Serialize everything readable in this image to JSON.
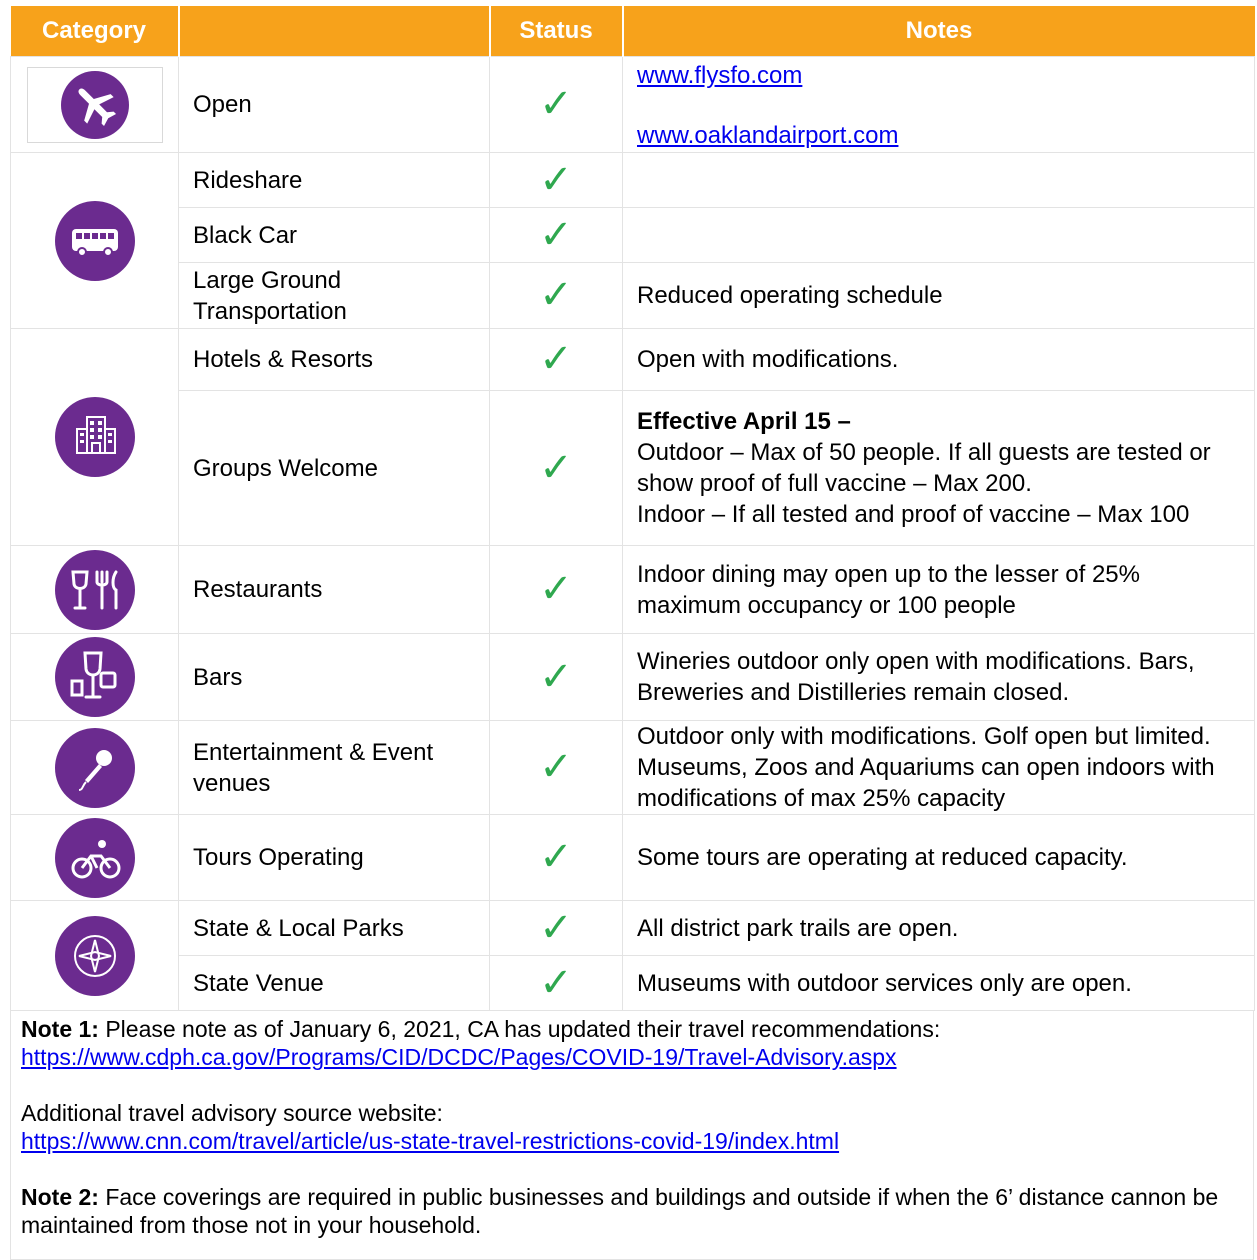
{
  "header": {
    "category": "Category",
    "status": "Status",
    "notes": "Notes"
  },
  "icons": {
    "air": "airplane-icon",
    "ground": "bus-icon",
    "lodging": "hotel-building-icon",
    "dining": "wine-fork-knife-icon",
    "bars": "cocktail-icon",
    "entertainment": "microphone-icon",
    "tours": "bicycle-icon",
    "parks": "compass-icon"
  },
  "colors": {
    "header_bg": "#f7a21b",
    "icon_bg": "#6b2b8f",
    "check": "#2fa84f",
    "link": "#0000ee"
  },
  "rows": {
    "open": {
      "name": "Open",
      "link1": "www.flysfo.com",
      "link2": "www.oaklandairport.com"
    },
    "rideshare": {
      "name": "Rideshare",
      "notes": ""
    },
    "blackcar": {
      "name": "Black Car",
      "notes": ""
    },
    "largeground": {
      "name_line1": "Large Ground",
      "name_line2": "Transportation",
      "notes": "Reduced operating schedule"
    },
    "hotels": {
      "name": "Hotels & Resorts",
      "notes": "Open with modifications."
    },
    "groups": {
      "name": "Groups Welcome",
      "notes_bold": "Effective April 15 –",
      "notes_line1": "Outdoor – Max of 50 people.  If all guests are tested or show proof of full vaccine – Max 200.",
      "notes_line2": "Indoor – If all tested and proof of vaccine – Max 100"
    },
    "restaurants": {
      "name": "Restaurants",
      "notes": "Indoor dining may open up to the lesser of 25% maximum occupancy or 100 people"
    },
    "bars": {
      "name": "Bars",
      "notes": "Wineries outdoor only open with modifications. Bars, Breweries and Distilleries remain closed."
    },
    "entertainment": {
      "name_line1": "Entertainment & Event",
      "name_line2": "venues",
      "notes": "Outdoor only with modifications.  Golf open but limited.  Museums, Zoos and Aquariums can open indoors with modifications of max 25% capacity"
    },
    "tours": {
      "name": "Tours Operating",
      "notes": "Some tours are operating at reduced capacity."
    },
    "parks": {
      "name": "State & Local Parks",
      "notes": "All district park trails are open."
    },
    "venue": {
      "name": "State Venue",
      "notes": "Museums with outdoor services only are open."
    }
  },
  "check_symbol": "✓",
  "footer": {
    "note1_label": "Note 1:",
    "note1_text": "  Please note as of January 6, 2021, CA has updated their travel recommendations:",
    "note1_link": "https://www.cdph.ca.gov/Programs/CID/DCDC/Pages/COVID-19/Travel-Advisory.aspx",
    "additional_text": "Additional travel advisory source website:",
    "additional_link": "https://www.cnn.com/travel/article/us-state-travel-restrictions-covid-19/index.html",
    "note2_label": "Note 2:",
    "note2_text": "  Face coverings are required in public businesses and buildings and outside if when the 6’ distance cannon be maintained from those not in your household."
  }
}
